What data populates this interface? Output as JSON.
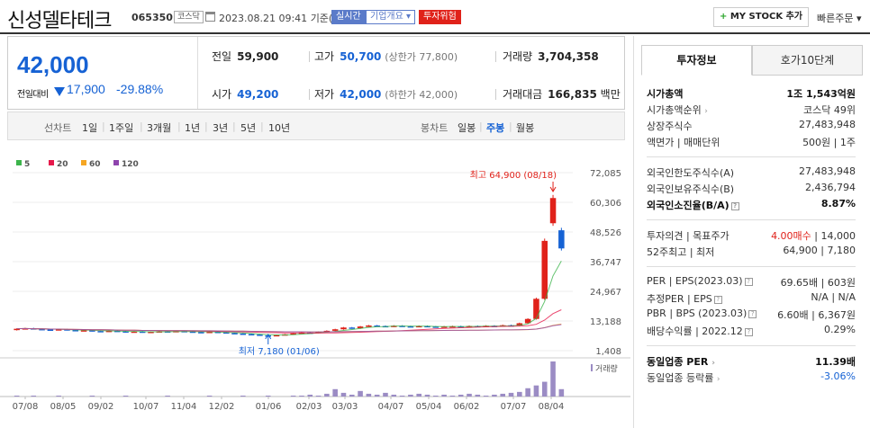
{
  "header": {
    "company_name": "신성델타테크",
    "code": "065350",
    "market": "코스닥",
    "datetime": "2023.08.21 09:41",
    "basis": "기준(장중)",
    "badge_realtime": "실시간",
    "badge_overview": "기업개요",
    "badge_risk": "투자위험",
    "mystock_label": "MY STOCK 추가",
    "quick_order": "빠른주문"
  },
  "price": {
    "current": "42,000",
    "change_label": "전일대비",
    "change_value": "17,900",
    "change_pct": "-29.88%",
    "prev_close_label": "전일",
    "prev_close": "59,900",
    "open_label": "시가",
    "open": "49,200",
    "high_label": "고가",
    "high": "50,700",
    "upper_limit": "(상한가 77,800)",
    "low_label": "저가",
    "low": "42,000",
    "lower_limit": "(하한가 42,000)",
    "volume_label": "거래량",
    "volume": "3,704,358",
    "amount_label": "거래대금",
    "amount": "166,835",
    "amount_unit": "백만"
  },
  "period_bar": {
    "line_label": "선차트",
    "line_items": [
      "1일",
      "1주일",
      "3개월",
      "1년",
      "3년",
      "5년",
      "10년"
    ],
    "candle_label": "봉차트",
    "candle_items": [
      "일봉",
      "주봉",
      "월봉"
    ],
    "active_candle": "주봉"
  },
  "chart_data": {
    "type": "candlestick",
    "legend": [
      "5",
      "20",
      "60",
      "120"
    ],
    "legend_colors": [
      "#3cb44b",
      "#e6194b",
      "#f5a623",
      "#8e44ad"
    ],
    "y_ticks": [
      "72,085",
      "60,306",
      "48,526",
      "36,747",
      "24,967",
      "13,188",
      "1,408"
    ],
    "ylim": [
      1408,
      72085
    ],
    "x_ticks": [
      "07/08",
      "08/05",
      "09/02",
      "10/07",
      "11/04",
      "12/02",
      "01/06",
      "02/03",
      "03/03",
      "04/07",
      "05/04",
      "06/02",
      "07/07",
      "08/04"
    ],
    "max_annotation": "최고 64,900 (08/18)",
    "min_annotation": "최저 7,180 (01/06)",
    "volume_label": "거래량",
    "candles": [
      {
        "o": 9600,
        "c": 10100
      },
      {
        "o": 10100,
        "c": 10300
      },
      {
        "o": 10300,
        "c": 10000
      },
      {
        "o": 10000,
        "c": 9800
      },
      {
        "o": 9800,
        "c": 9700
      },
      {
        "o": 9700,
        "c": 9900
      },
      {
        "o": 9900,
        "c": 9600
      },
      {
        "o": 9600,
        "c": 9300
      },
      {
        "o": 9300,
        "c": 9500
      },
      {
        "o": 9500,
        "c": 9200
      },
      {
        "o": 9200,
        "c": 9000
      },
      {
        "o": 9000,
        "c": 9300
      },
      {
        "o": 9300,
        "c": 9100
      },
      {
        "o": 9100,
        "c": 8800
      },
      {
        "o": 8800,
        "c": 9000
      },
      {
        "o": 9000,
        "c": 8700
      },
      {
        "o": 8700,
        "c": 8900
      },
      {
        "o": 8900,
        "c": 9100
      },
      {
        "o": 9100,
        "c": 8900
      },
      {
        "o": 8900,
        "c": 9200
      },
      {
        "o": 9200,
        "c": 9000
      },
      {
        "o": 9000,
        "c": 8800
      },
      {
        "o": 8800,
        "c": 8600
      },
      {
        "o": 8600,
        "c": 8900
      },
      {
        "o": 8900,
        "c": 8700
      },
      {
        "o": 8700,
        "c": 8400
      },
      {
        "o": 8400,
        "c": 8200
      },
      {
        "o": 8200,
        "c": 8000
      },
      {
        "o": 8000,
        "c": 7800
      },
      {
        "o": 7800,
        "c": 7500
      },
      {
        "o": 7500,
        "c": 7400
      },
      {
        "o": 7400,
        "c": 7600
      },
      {
        "o": 7600,
        "c": 7900
      },
      {
        "o": 7900,
        "c": 8300
      },
      {
        "o": 8300,
        "c": 8600
      },
      {
        "o": 8600,
        "c": 8500
      },
      {
        "o": 8500,
        "c": 8900
      },
      {
        "o": 8900,
        "c": 9300
      },
      {
        "o": 9300,
        "c": 9900
      },
      {
        "o": 9900,
        "c": 10600
      },
      {
        "o": 10600,
        "c": 10300
      },
      {
        "o": 10300,
        "c": 11000
      },
      {
        "o": 11000,
        "c": 11400
      },
      {
        "o": 11400,
        "c": 11200
      },
      {
        "o": 11200,
        "c": 11000
      },
      {
        "o": 11000,
        "c": 11300
      },
      {
        "o": 11300,
        "c": 11100
      },
      {
        "o": 11100,
        "c": 10900
      },
      {
        "o": 10900,
        "c": 11200
      },
      {
        "o": 11200,
        "c": 11000
      },
      {
        "o": 11000,
        "c": 10800
      },
      {
        "o": 10800,
        "c": 11000
      },
      {
        "o": 11000,
        "c": 11100
      },
      {
        "o": 11100,
        "c": 10900
      },
      {
        "o": 10900,
        "c": 11200
      },
      {
        "o": 11200,
        "c": 11000
      },
      {
        "o": 11000,
        "c": 11300
      },
      {
        "o": 11300,
        "c": 11100
      },
      {
        "o": 11100,
        "c": 11500
      },
      {
        "o": 11500,
        "c": 11400
      },
      {
        "o": 11400,
        "c": 12300
      },
      {
        "o": 12300,
        "c": 14000
      },
      {
        "o": 14000,
        "c": 22000
      },
      {
        "o": 22000,
        "c": 45000
      },
      {
        "o": 52000,
        "c": 62000
      },
      {
        "o": 49200,
        "c": 42000
      }
    ],
    "volumes": [
      1,
      0,
      1,
      0,
      0,
      1,
      0,
      0,
      0,
      1,
      0,
      0,
      0,
      1,
      0,
      0,
      0,
      0,
      1,
      0,
      0,
      0,
      0,
      1,
      0,
      0,
      0,
      1,
      0,
      0,
      1,
      0,
      0,
      1,
      1,
      2,
      1,
      3,
      8,
      4,
      2,
      6,
      3,
      2,
      4,
      2,
      1,
      2,
      3,
      2,
      1,
      2,
      1,
      2,
      3,
      2,
      1,
      2,
      3,
      4,
      5,
      9,
      12,
      16,
      38,
      8
    ]
  },
  "right_panel": {
    "tab_active": "투자정보",
    "tab_other": "호가10단계",
    "rows1": [
      {
        "k": "시가총액",
        "v": "1조 1,543억원"
      },
      {
        "k": "시가총액순위",
        "v": "코스닥 49위"
      },
      {
        "k": "상장주식수",
        "v": "27,483,948"
      },
      {
        "k": "액면가 | 매매단위",
        "v": "500원 | 1주"
      }
    ],
    "rows2": [
      {
        "k": "외국인한도주식수(A)",
        "v": "27,483,948"
      },
      {
        "k": "외국인보유주식수(B)",
        "v": "2,436,794"
      },
      {
        "k": "외국인소진율(B/A)",
        "v": "8.87%"
      }
    ],
    "rows3": [
      {
        "k": "투자의견 | 목표주가",
        "v_red": "4.00매수",
        "v": "14,000"
      },
      {
        "k": "52주최고 | 최저",
        "v": "64,900 | 7,180"
      }
    ],
    "rows4": [
      {
        "k": "PER | EPS(2023.03)",
        "v": "69.65배 | 603원"
      },
      {
        "k": "추정PER | EPS",
        "v": "N/A | N/A"
      },
      {
        "k": "PBR | BPS (2023.03)",
        "v": "6.60배 | 6,367원"
      },
      {
        "k": "배당수익률 | 2022.12",
        "v": "0.29%"
      }
    ],
    "rows5": [
      {
        "k": "동일업종 PER",
        "v": "11.39배"
      },
      {
        "k": "동일업종 등락률",
        "v": "-3.06%"
      }
    ]
  }
}
